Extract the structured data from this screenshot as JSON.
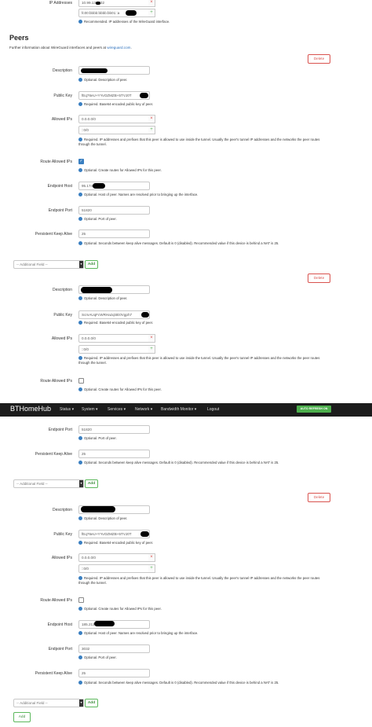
{
  "top": {
    "ip_label": "IP Addresses",
    "ip1": "10.99.13",
    "ip1b": "32",
    "ip2": "fc00:bbbb:bbbb:bb01::a",
    "ip_help": "Recommended. IP addresses of the WireGuard interface."
  },
  "peers": {
    "title": "Peers",
    "desc_prefix": "Further information about WireGuard interfaces and peers at ",
    "desc_link": "wireguard.com",
    "desc_suffix": "."
  },
  "labels": {
    "description": "Description",
    "public_key": "Public Key",
    "allowed_ips": "Allowed IPs",
    "route_allowed_ips": "Route Allowed IPs",
    "endpoint_host": "Endpoint Host",
    "endpoint_port": "Endpoint Port",
    "keepalive": "Persistent Keep Alive"
  },
  "help": {
    "description": "Optional. Description of peer.",
    "public_key": "Required. Base64-encoded public key of peer.",
    "allowed_ips": "Required. IP addresses and prefixes that this peer is allowed to use inside the tunnel. Usually the peer's tunnel IP addresses and the networks the peer routes through the tunnel.",
    "route": "Optional. Create routes for Allowed IPs for this peer.",
    "endpoint_host": "Optional. Host of peer. Names are resolved prior to bringing up the interface.",
    "endpoint_port": "Optional. Port of peer.",
    "keepalive": "Optional. Seconds between keep alive messages. Default is 0 (disabled). Recommended value if this device is behind a NAT is 25."
  },
  "buttons": {
    "delete": "Delete",
    "add": "Add",
    "additional_field": "-- Additional Field --",
    "x": "×",
    "plus": "+"
  },
  "peer1": {
    "public_key": "fEq76eU+YYvOZMZB+5TVJ0T",
    "allowed_ip1": "0.0.0.0/0",
    "allowed_ip2": "::0/0",
    "endpoint_host": "95.174",
    "endpoint_port": "51820",
    "keepalive": "25"
  },
  "peer2": {
    "public_key": "ScmAUqFcWRHazql4E0Vgph7",
    "allowed_ip1": "0.0.0.0/0",
    "allowed_ip2": "::0/0",
    "endpoint_port": "51820",
    "keepalive": "25"
  },
  "peer3": {
    "public_key": "fEq76eU+YYvOZMZB+5TVJ0T",
    "allowed_ip1": "0.0.0.0/0",
    "allowed_ip2": "::0/0",
    "endpoint_host": "185.213",
    "endpoint_port": "3032",
    "keepalive": "25"
  },
  "navbar": {
    "brand": "BTHomeHub",
    "items": [
      "Status",
      "System",
      "Services",
      "Network",
      "Bandwidth Monitor",
      "Logout"
    ],
    "auto_refresh": "AUTO REFRESH ON"
  }
}
